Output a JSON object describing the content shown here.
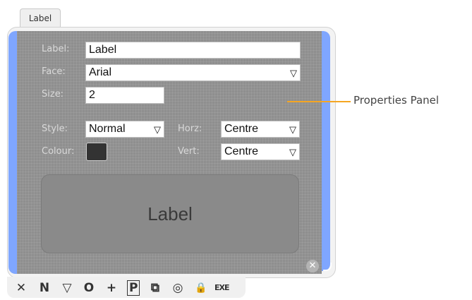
{
  "tab": {
    "label": "Label"
  },
  "form": {
    "label_label": "Label:",
    "label_value": "Label",
    "face_label": "Face:",
    "face_value": "Arial",
    "size_label": "Size:",
    "size_value": "2",
    "style_label": "Style:",
    "style_value": "Normal",
    "colour_label": "Colour:",
    "colour_value": "#333333",
    "horz_label": "Horz:",
    "horz_value": "Centre",
    "vert_label": "Vert:",
    "vert_value": "Centre",
    "dropdown_arrow": "▽"
  },
  "preview": {
    "text": "Label"
  },
  "close": {
    "glyph": "✕"
  },
  "toolbar": {
    "tools": [
      {
        "name": "delete",
        "glyph": "✕"
      },
      {
        "name": "new",
        "glyph": "N"
      },
      {
        "name": "dropdown",
        "glyph": "▽"
      },
      {
        "name": "shape",
        "glyph": "O"
      },
      {
        "name": "add",
        "glyph": "+"
      },
      {
        "name": "properties",
        "glyph": "P",
        "active": true
      },
      {
        "name": "duplicate",
        "glyph": "⧉"
      },
      {
        "name": "view",
        "glyph": "◎"
      },
      {
        "name": "lock",
        "glyph": "🔒"
      },
      {
        "name": "exe",
        "glyph": "EXE"
      }
    ]
  },
  "callout": {
    "text": "Properties Panel"
  },
  "colors": {
    "accent_stripe": "#7fa6ff",
    "callout_line": "#f5a623",
    "panel_bg": "#8f8f8f"
  }
}
